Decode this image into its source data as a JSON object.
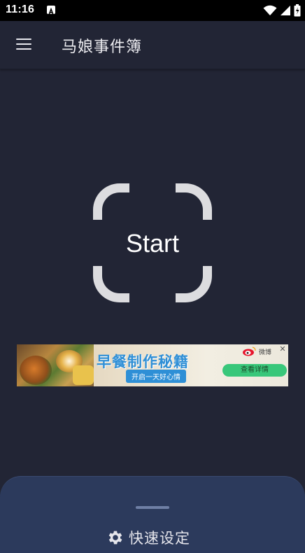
{
  "status_bar": {
    "time": "11:16"
  },
  "app_bar": {
    "title": "马娘事件簿"
  },
  "main": {
    "start_label": "Start"
  },
  "ad": {
    "headline": "早餐制作秘籍",
    "subline": "开启一天好心情",
    "brand": "微博",
    "cta": "查看详情",
    "close_glyph": "✕"
  },
  "bottom_sheet": {
    "title": "快速设定"
  },
  "colors": {
    "background": "#222535",
    "sheet": "#2c3a5c",
    "accent_ad": "#2f8fd6"
  },
  "icons": [
    "menu-icon",
    "wifi-icon",
    "signal-icon",
    "battery-icon",
    "gear-icon",
    "weibo-icon"
  ]
}
